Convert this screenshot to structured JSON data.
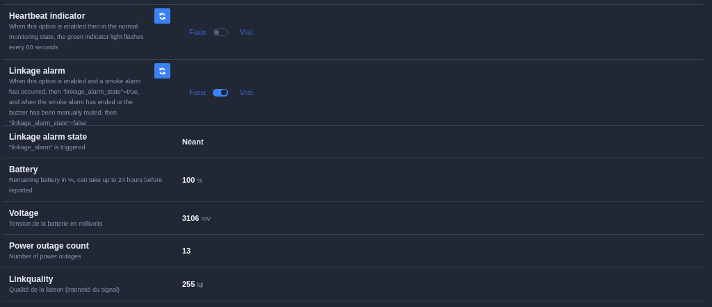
{
  "settings": [
    {
      "kind": "toggle",
      "title": "Heartbeat indicator",
      "description": "When this option is enabled then in the normal monitoring state, the green indicator light flashes every 60 seconds",
      "off_label": "Faux",
      "on_label": "Vrai",
      "on": false
    },
    {
      "kind": "toggle",
      "title": "Linkage alarm",
      "description": "When this option is enabled and a smoke alarm has occurred, then \"linkage_alarm_state\"=true, and when the smoke alarm has ended or the buzzer has been manually muted, then \"linkage_alarm_state\"=false",
      "off_label": "Faux",
      "on_label": "Vrai",
      "on": true
    },
    {
      "kind": "value",
      "title": "Linkage alarm state",
      "description": "\"linkage_alarm\" is triggered",
      "value": "Néant"
    },
    {
      "kind": "value",
      "title": "Battery",
      "description": "Remaining battery in %, can take up to 24 hours before reported",
      "value": "100",
      "unit": "%"
    },
    {
      "kind": "value",
      "title": "Voltage",
      "description": "Tension de la batterie en millivolts",
      "value": "3106",
      "unit": "mV"
    },
    {
      "kind": "value",
      "title": "Power outage count",
      "description": "Number of power outages",
      "value": "13"
    },
    {
      "kind": "value",
      "title": "Linkquality",
      "description": "Qualité de la liaison (intensité du signal)",
      "value": "255",
      "unit": "lqi"
    }
  ]
}
